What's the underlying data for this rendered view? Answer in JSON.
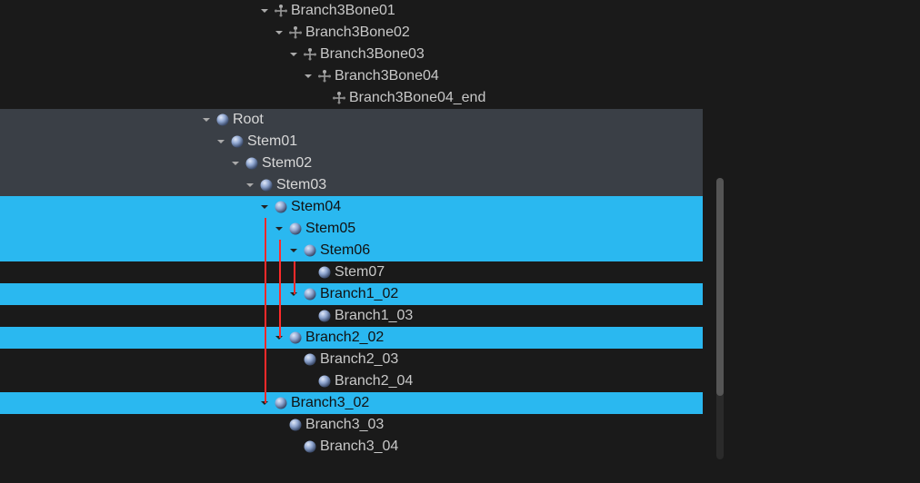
{
  "colors": {
    "bg": "#1a1a1a",
    "sel_grey": "#3a3f46",
    "sel_cyan": "#2ab8f0",
    "text_light": "#c8c8c8",
    "text_dark": "#111111"
  },
  "icon_names": {
    "bone": "bone-icon",
    "sphere": "sphere-icon",
    "chevron": "chevron-down-icon"
  },
  "tree_rows": [
    {
      "indent": 4,
      "expandable": true,
      "icon": "bone",
      "label": "Branch3Bone01",
      "selection": "plain"
    },
    {
      "indent": 5,
      "expandable": true,
      "icon": "bone",
      "label": "Branch3Bone02",
      "selection": "plain"
    },
    {
      "indent": 6,
      "expandable": true,
      "icon": "bone",
      "label": "Branch3Bone03",
      "selection": "plain"
    },
    {
      "indent": 7,
      "expandable": true,
      "icon": "bone",
      "label": "Branch3Bone04",
      "selection": "plain"
    },
    {
      "indent": 8,
      "expandable": false,
      "icon": "bone",
      "label": "Branch3Bone04_end",
      "selection": "plain"
    },
    {
      "indent": 0,
      "expandable": true,
      "icon": "sphere",
      "label": "Root",
      "selection": "grey"
    },
    {
      "indent": 1,
      "expandable": true,
      "icon": "sphere",
      "label": "Stem01",
      "selection": "grey"
    },
    {
      "indent": 2,
      "expandable": true,
      "icon": "sphere",
      "label": "Stem02",
      "selection": "grey"
    },
    {
      "indent": 3,
      "expandable": true,
      "icon": "sphere",
      "label": "Stem03",
      "selection": "grey"
    },
    {
      "indent": 4,
      "expandable": true,
      "icon": "sphere",
      "label": "Stem04",
      "selection": "cyan"
    },
    {
      "indent": 5,
      "expandable": true,
      "icon": "sphere",
      "label": "Stem05",
      "selection": "cyan"
    },
    {
      "indent": 6,
      "expandable": true,
      "icon": "sphere",
      "label": "Stem06",
      "selection": "cyan"
    },
    {
      "indent": 7,
      "expandable": false,
      "icon": "sphere",
      "label": "Stem07",
      "selection": "plain"
    },
    {
      "indent": 6,
      "expandable": true,
      "icon": "sphere",
      "label": "Branch1_02",
      "selection": "cyan"
    },
    {
      "indent": 7,
      "expandable": false,
      "icon": "sphere",
      "label": "Branch1_03",
      "selection": "plain"
    },
    {
      "indent": 5,
      "expandable": true,
      "icon": "sphere",
      "label": "Branch2_02",
      "selection": "cyan"
    },
    {
      "indent": 6,
      "expandable": false,
      "icon": "sphere",
      "label": "Branch2_03",
      "selection": "plain"
    },
    {
      "indent": 7,
      "expandable": false,
      "icon": "sphere",
      "label": "Branch2_04",
      "selection": "plain"
    },
    {
      "indent": 4,
      "expandable": true,
      "icon": "sphere",
      "label": "Branch3_02",
      "selection": "cyan"
    },
    {
      "indent": 5,
      "expandable": false,
      "icon": "sphere",
      "label": "Branch3_03",
      "selection": "plain"
    },
    {
      "indent": 6,
      "expandable": false,
      "icon": "sphere",
      "label": "Branch3_04",
      "selection": "plain"
    }
  ],
  "guide_lines": [
    {
      "from_row": 9,
      "to_row": 18,
      "at_indent": 4
    },
    {
      "from_row": 10,
      "to_row": 15,
      "at_indent": 5
    },
    {
      "from_row": 11,
      "to_row": 13,
      "at_indent": 6
    }
  ]
}
